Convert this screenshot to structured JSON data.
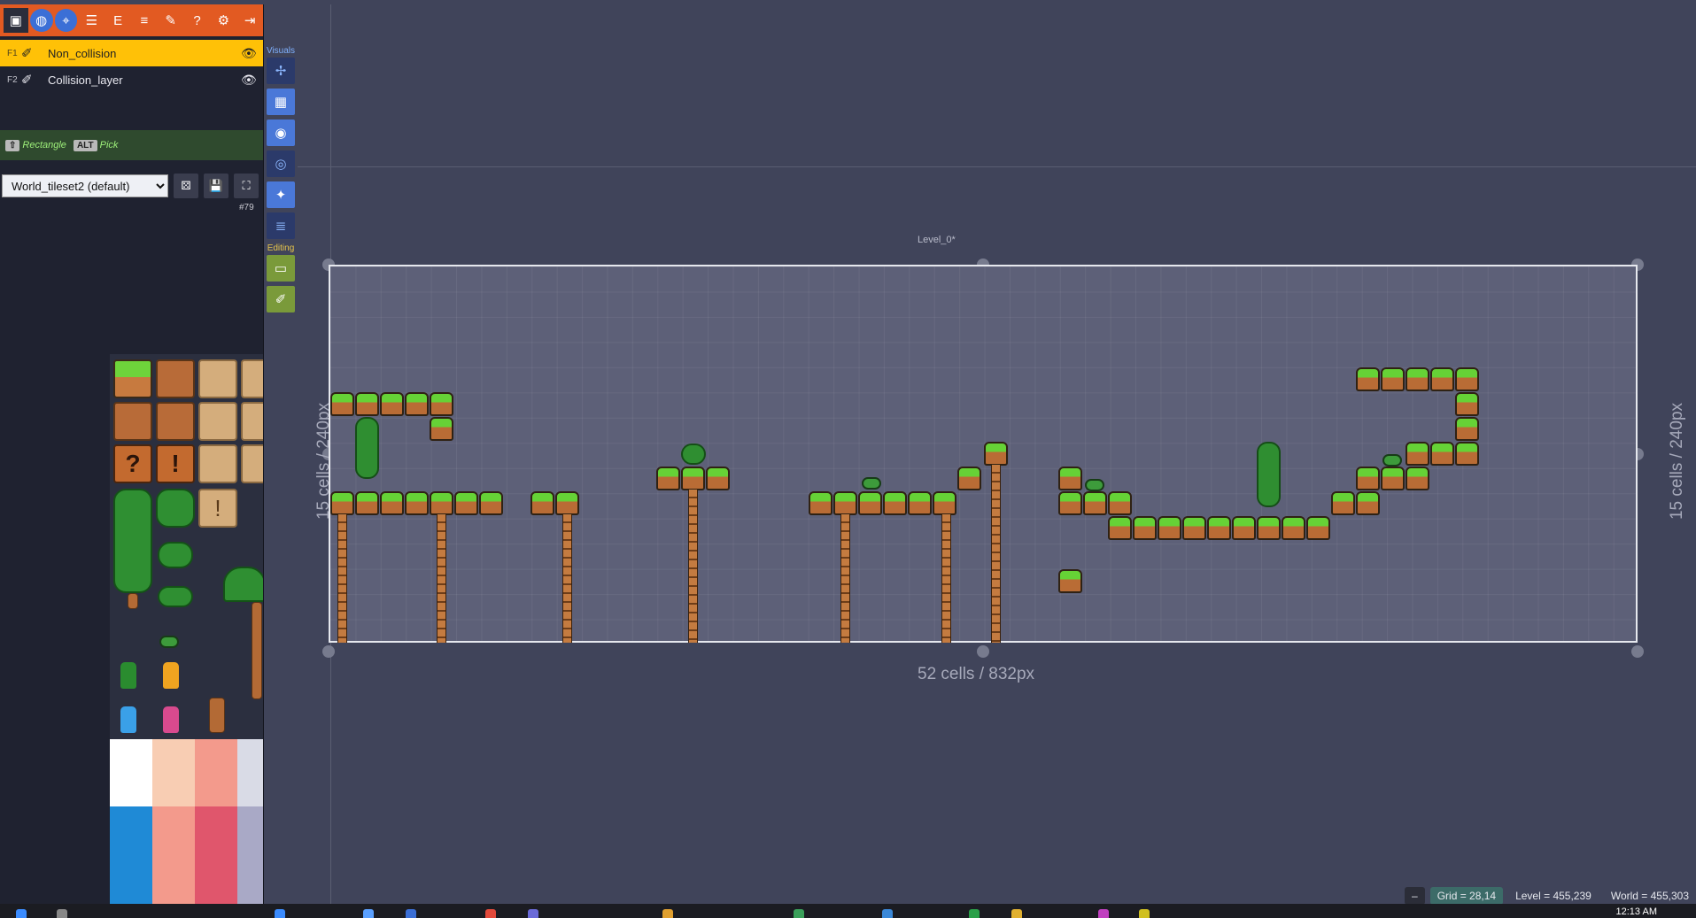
{
  "toolbar": {
    "icons": [
      "project-icon",
      "world-icon",
      "map-pin-icon",
      "layers-icon",
      "entities-icon",
      "list-icon",
      "tools-icon",
      "help-icon",
      "settings-icon",
      "exit-icon"
    ]
  },
  "layers": [
    {
      "key": "F1",
      "name": "Non_collision",
      "active": true
    },
    {
      "key": "F2",
      "name": "Collision_layer",
      "active": false
    }
  ],
  "hint": {
    "shift_key": "⇧",
    "rect_label": "Rectangle",
    "alt_key": "ALT",
    "pick_label": "Pick"
  },
  "tileset": {
    "selected": "World_tileset2 (default)",
    "count": "#79"
  },
  "vtools": {
    "visuals_label": "Visuals",
    "editing_label": "Editing"
  },
  "level": {
    "name": "Level_0*",
    "width_label": "52 cells / 832px",
    "height_label": "15 cells / 240px"
  },
  "status": {
    "minus": "–",
    "grid": "Grid = 28,14",
    "level": "Level = 455,239",
    "world": "World = 455,303"
  },
  "taskbar": {
    "clock": "12:13 AM"
  },
  "colors": {
    "accent": "#e25a22",
    "active_layer": "#ffc107",
    "world_bg": "#40445a",
    "level_bg": "#5d6078"
  }
}
